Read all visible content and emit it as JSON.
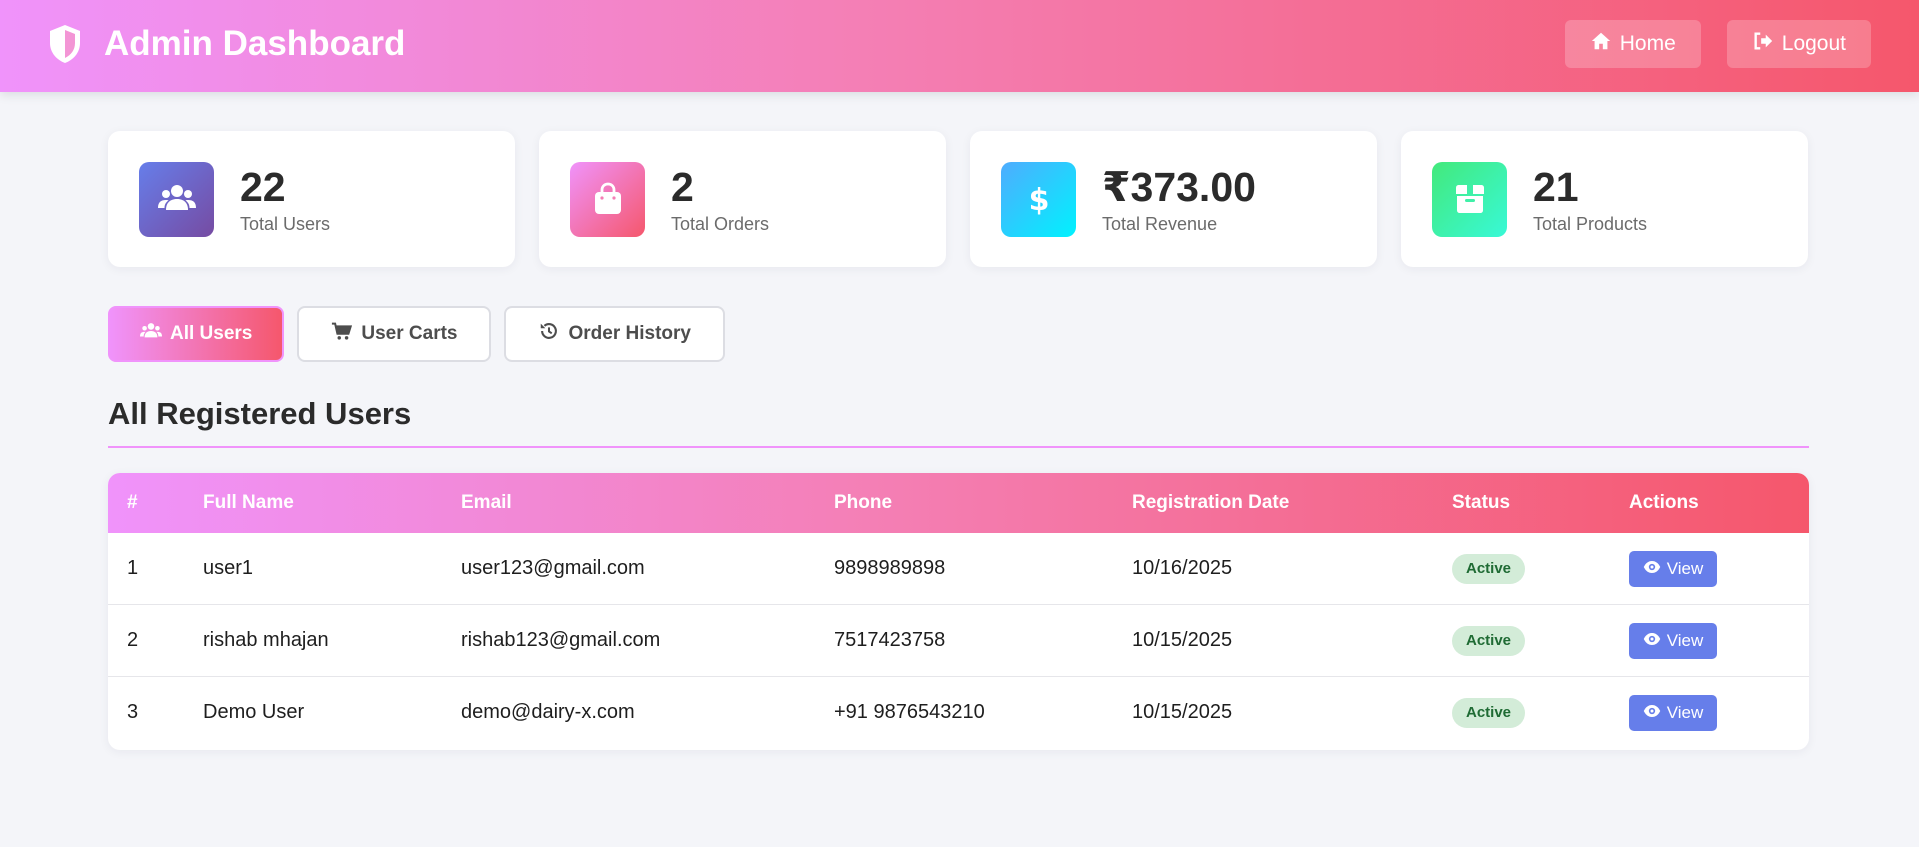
{
  "header": {
    "title": "Admin Dashboard",
    "nav": [
      {
        "label": "Home",
        "icon": "home-icon"
      },
      {
        "label": "Logout",
        "icon": "logout-icon"
      }
    ]
  },
  "stats": [
    {
      "value": "22",
      "label": "Total Users",
      "icon": "users-icon",
      "color": "#667eea"
    },
    {
      "value": "2",
      "label": "Total Orders",
      "icon": "shopping-bag-icon",
      "color": "#f5576c"
    },
    {
      "value": "₹373.00",
      "label": "Total Revenue",
      "icon": "dollar-icon",
      "color": "#4facfe"
    },
    {
      "value": "21",
      "label": "Total Products",
      "icon": "box-icon",
      "color": "#43e97b"
    }
  ],
  "tabs": [
    {
      "label": "All Users",
      "icon": "users-icon",
      "active": true
    },
    {
      "label": "User Carts",
      "icon": "cart-icon",
      "active": false
    },
    {
      "label": "Order History",
      "icon": "history-icon",
      "active": false
    }
  ],
  "section": {
    "title": "All Registered Users"
  },
  "table": {
    "columns": [
      "#",
      "Full Name",
      "Email",
      "Phone",
      "Registration Date",
      "Status",
      "Actions"
    ],
    "rows": [
      {
        "num": "1",
        "name": "user1",
        "email": "user123@gmail.com",
        "phone": "9898989898",
        "date": "10/16/2025",
        "status": "Active",
        "action": "View"
      },
      {
        "num": "2",
        "name": "rishab mhajan",
        "email": "rishab123@gmail.com",
        "phone": "7517423758",
        "date": "10/15/2025",
        "status": "Active",
        "action": "View"
      },
      {
        "num": "3",
        "name": "Demo User",
        "email": "demo@dairy-x.com",
        "phone": "+91 9876543210",
        "date": "10/15/2025",
        "status": "Active",
        "action": "View"
      }
    ]
  },
  "colors": {
    "accent_start": "#f093fb",
    "accent_end": "#f5576c",
    "view_button": "#667eea",
    "status_active_bg": "#d3ecd8"
  }
}
